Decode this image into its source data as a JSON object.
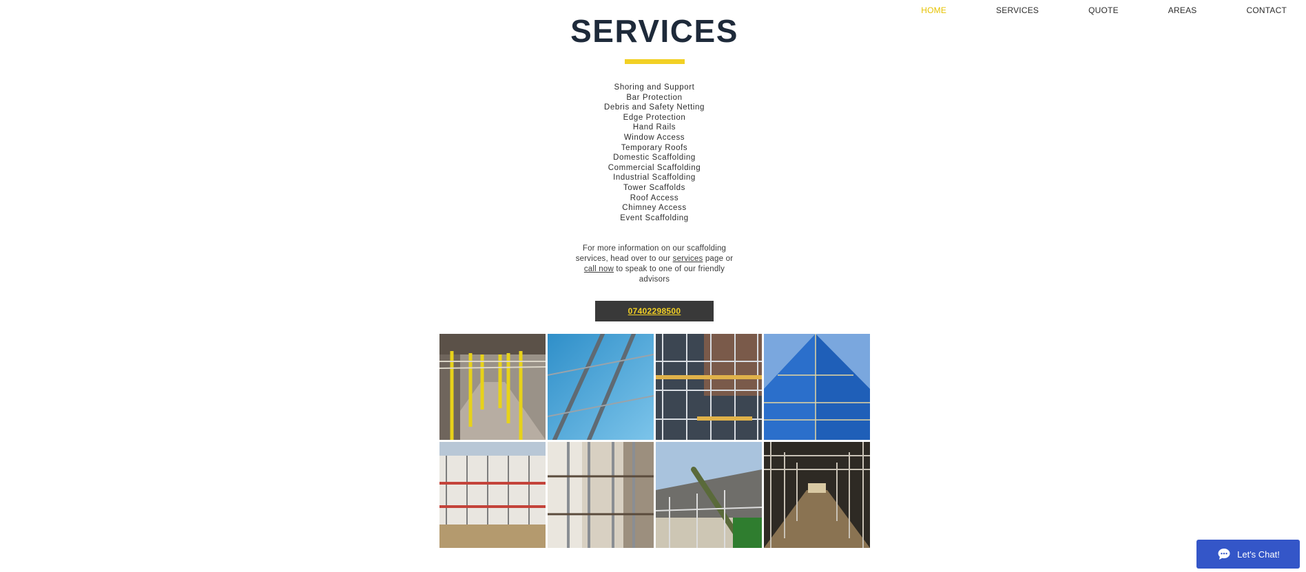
{
  "nav": {
    "items": [
      {
        "label": "HOME",
        "active": true
      },
      {
        "label": "SERVICES",
        "active": false
      },
      {
        "label": "QUOTE",
        "active": false
      },
      {
        "label": "AREAS",
        "active": false
      },
      {
        "label": "CONTACT",
        "active": false
      }
    ],
    "active_color": "#e6c200"
  },
  "heading": {
    "title": "SERVICES",
    "accent_color": "#f2d024"
  },
  "services_list": [
    "Shoring and Support",
    "Bar Protection",
    "Debris and Safety Netting",
    "Edge Protection",
    "Hand Rails",
    "Window Access",
    "Temporary Roofs",
    "Domestic Scaffolding",
    "Commercial Scaffolding",
    "Industrial Scaffolding",
    "Tower Scaffolds",
    "Roof Access",
    "Chimney Access",
    "Event Scaffolding"
  ],
  "info": {
    "text_1": "For more information on our scaffolding services, head over to our ",
    "link_services": "services",
    "text_2": " page or ",
    "link_call": "call now",
    "text_3": " to speak to one of our friendly advisors"
  },
  "phone_button": {
    "label": "07402298500"
  },
  "gallery": {
    "images": [
      {
        "name": "gallery-image-shoring-yellow-props"
      },
      {
        "name": "gallery-image-blue-netting"
      },
      {
        "name": "gallery-image-building-facade-scaffold"
      },
      {
        "name": "gallery-image-tall-blue-sheeted-scaffold"
      },
      {
        "name": "gallery-image-white-building-scaffold"
      },
      {
        "name": "gallery-image-interior-scaffold"
      },
      {
        "name": "gallery-image-roof-scaffold-crane"
      },
      {
        "name": "gallery-image-scaffold-tunnel"
      }
    ]
  },
  "chat": {
    "label": "Let's Chat!",
    "color": "#3456c8"
  }
}
